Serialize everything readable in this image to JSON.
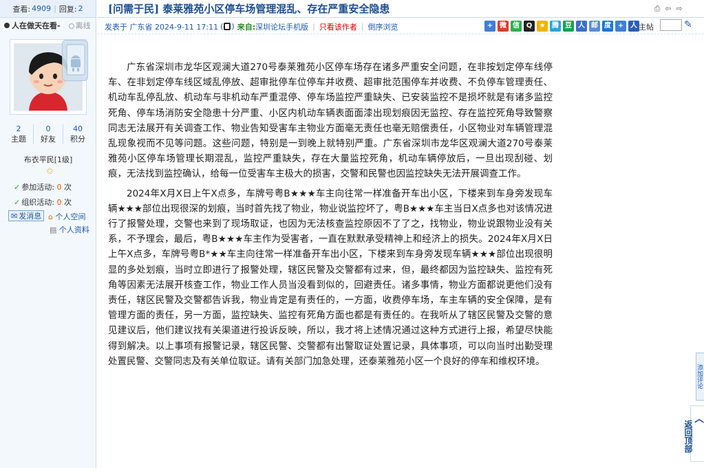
{
  "left": {
    "views_label": "查看:",
    "views_value": "4909",
    "replies_label": "回复:",
    "replies_value": "2",
    "status_text": "人在做天在看-",
    "offline_text": "离线",
    "stats": [
      {
        "value": "2",
        "label": "主题"
      },
      {
        "value": "0",
        "label": "好友"
      },
      {
        "value": "40",
        "label": "积分"
      }
    ],
    "rank": "布衣平民[1级]",
    "join_label": "参加活动:",
    "join_count": "0",
    "org_label": "组织活动:",
    "org_count": "0",
    "unit": "次",
    "msg_button": "发消息",
    "space_link": "个人空间",
    "profile_link": "个人资料"
  },
  "post": {
    "title": "[问需于民] 泰莱雅苑小区停车场管理混乱、存在严重安全隐患",
    "posted_prefix": "发表于 广东省 2024-9-11 17:11",
    "from_label": "来自:",
    "from_value": "深圳论坛手机版",
    "only_author": "只看该作者",
    "reverse_browse": "倒序浏览",
    "floor_label": "主帖",
    "paragraphs": [
      "广东省深圳市龙华区观澜大道270号泰莱雅苑小区停车场存在诸多严重安全问题，在非按划定停车线停车、在非划定停车线区域乱停放、超审批停车位停车并收费、超审批范围停车并收费、不负停车管理责任、机动车乱停乱放、机动车与非机动车严重混停、停车场监控严重缺失、已安装监控不是损坏就是有诸多监控死角、停车场消防安全隐患十分严重、小区内机动车辆表面面漆出现划痕因无监控、存在监控死角导致警察同志无法展开有关调查工作、物业告知受害车主物业方面毫无责任也毫无赔偿责任，小区物业对车辆管理混乱现象视而不见等问题。这些问题，特别是一到晚上就特别严重。广东省深圳市龙华区观澜大道270号泰莱雅苑小区停车场管理长期混乱，监控严重缺失，存在大量监控死角，机动车辆停放后，一旦出现刮碰、划痕，无法找到监控确认，给每一位受害车主极大的损害，交警和民警也因监控缺失无法开展调查工作。",
      "2024年X月X日上午X点多，车牌号粤B★★★车主向往常一样准备开车出小区，下楼来到车身旁发现车辆★★★部位出现很深的划痕，当时首先找了物业，物业说监控坏了，粤B★★★车主当日X点多也对该情况进行了报警处理，交警也来到了现场取证，也因为无法核查监控原因不了了之，找物业，物业说跟物业没有关系，不予理会，最后，粤B★★★车主作为受害者，一直在默默承受精神上和经济上的损失。2024年X月X日上午X点多，车牌号粤B*★★车主向往常一样准备开车出小区，下楼来到车身旁发现车辆★★★部位出现很明显的多处划痕，当时立即进行了报警处理，辖区民警及交警都有过来，但，最终都因为监控缺失、监控有死角等因素无法展开核查工作，物业工作人员当没看到似的，回避责任。诸多事情，物业方面都说更他们没有责任，辖区民警及交警都告诉我，物业肯定是有责任的，一方面，收费停车场，车主车辆的安全保障，是有管理方面的责任，另一方面，监控缺失、监控有死角方面也都是有责任的。在我听从了辖区民警及交警的意见建议后，他们建议找有关渠道进行投诉反映，所以，我才将上述情况通过这种方式进行上报，希望尽快能得到解决。以上事项有报警记录，辖区民警、交警都有出警取证处置记录，具体事项，可以向当时出勤受理处置民警、交警同志及有关单位取证。请有关部门加急处理，还泰莱雅苑小区一个良好的停车和维权环境。"
    ]
  },
  "side": {
    "float_text": "添加评论",
    "back_top": "返回顶部"
  },
  "colors": {
    "accent": "#1f5aa8",
    "title": "#1f4f8f",
    "border": "#c8dcf0"
  }
}
